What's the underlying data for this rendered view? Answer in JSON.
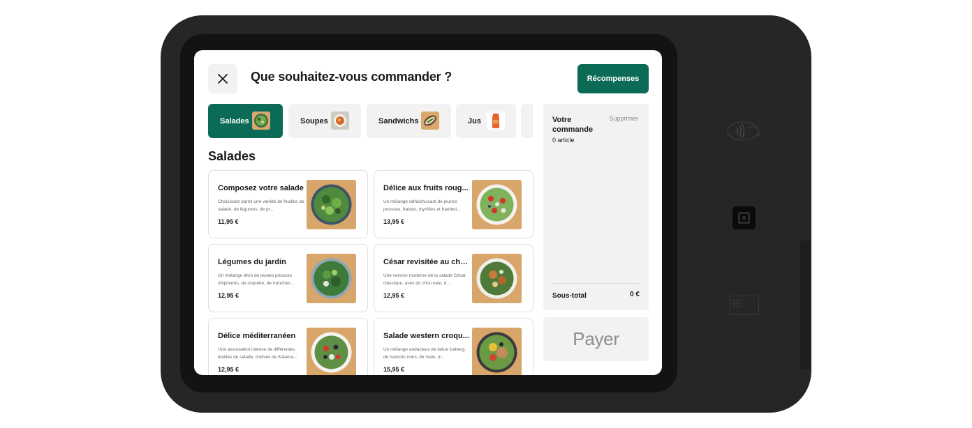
{
  "header": {
    "title": "Que souhaitez-vous commander ?",
    "rewards_label": "Récompenses",
    "close_icon": "close-icon"
  },
  "tabs": [
    {
      "label": "Salades",
      "active": true,
      "icon": "salad-thumbnail"
    },
    {
      "label": "Soupes",
      "active": false,
      "icon": "soup-thumbnail"
    },
    {
      "label": "Sandwichs",
      "active": false,
      "icon": "sandwich-thumbnail"
    },
    {
      "label": "Jus",
      "active": false,
      "icon": "juice-thumbnail"
    }
  ],
  "section_title": "Salades",
  "items": [
    {
      "name": "Composez votre salade",
      "desc": "Choisissez parmi une variété de feuilles de salade, de légumes, de pr...",
      "price": "11,95 €"
    },
    {
      "name": "Délice aux fruits roug...",
      "desc": "Un mélange rafraîchissant de jeunes pousses, fraises, myrtilles et framboi...",
      "price": "13,95 €"
    },
    {
      "name": "Légumes du jardin",
      "desc": "Un mélange divin de jeunes pousses d'épinards, de roquette, de tranches...",
      "price": "12,95 €"
    },
    {
      "name": "César revisitée au cho...",
      "desc": "Une version moderne de la salade César classique, avec du chou kale, d...",
      "price": "12,95 €"
    },
    {
      "name": "Délice méditerranéen",
      "desc": "Une association intense de différentes feuilles de salade, d'olives de Kalama...",
      "price": "12,95 €"
    },
    {
      "name": "Salade western croqu...",
      "desc": "Un mélange audacieux de laitue iceberg, de haricots noirs, de maïs, d...",
      "price": "15,95 €"
    }
  ],
  "order": {
    "title": "Votre commande",
    "delete_label": "Supprimer",
    "count": "0 article",
    "subtotal_label": "Sous-total",
    "subtotal_value": "0 €"
  },
  "pay_label": "Payer",
  "colors": {
    "accent": "#0b6b57",
    "panel": "#f2f2f2",
    "device": "#262626"
  }
}
